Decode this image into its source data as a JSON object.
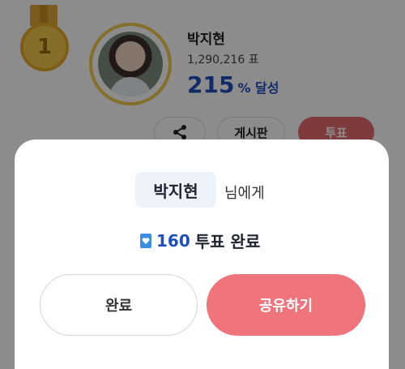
{
  "background": {
    "rank": "1",
    "artist_name": "박지현",
    "vote_count": "1,290,216 표",
    "achievement_value": "215",
    "achievement_suffix": "% 달성",
    "board_label": "게시판",
    "vote_label": "투표"
  },
  "modal": {
    "name": "박지현",
    "name_suffix": "님에게",
    "vote_amount": "160",
    "vote_done_label": "투표 완료",
    "done_button": "완료",
    "share_button": "공유하기"
  },
  "colors": {
    "accent_blue": "#1f4fbf",
    "share_pink": "#f0747c",
    "ticket_blue": "#3b8de6",
    "gold": "#f2c94c"
  },
  "icons": {
    "medal": "gold-medal-icon",
    "share": "share-icon",
    "ticket": "heart-ticket-icon"
  }
}
